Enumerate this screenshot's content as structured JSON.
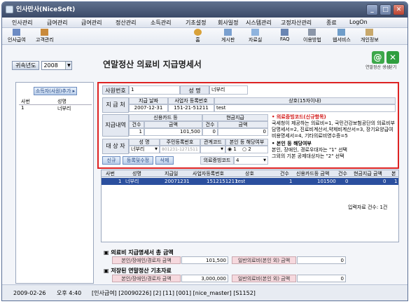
{
  "window": {
    "title": "인사만사(NiceSoft)"
  },
  "menu": [
    "인사관리",
    "급여관리",
    "급여관리",
    "정산관리",
    "소득관리",
    "기초설정",
    "회사일정",
    "시스템관리",
    "고정자산관리",
    "종료",
    "LogOn"
  ],
  "toolbar": {
    "left": [
      "인사급여",
      "고객관리"
    ],
    "right": [
      "홈",
      "게시판",
      "자료실",
      "FAQ",
      "이용방법",
      "웹서비스",
      "개인정보"
    ]
  },
  "page": {
    "title": "연말정산 의료비 지급명세서",
    "year_label": "귀속년도",
    "year_value": "2008",
    "btn_annual": "연말정산 생성",
    "btn_close": "닫기"
  },
  "left": {
    "button": "소득자(사원)추가 ▸",
    "headers": [
      "사번",
      "성명"
    ],
    "rows": [
      [
        "1",
        "너부리"
      ]
    ]
  },
  "form": {
    "emp_no_label": "사원번호",
    "emp_no": "1",
    "name_label": "성 명",
    "name": "너부리",
    "payee_label": "지 급 처",
    "pay_date_h": "지급 날짜",
    "bizno_h": "사업자 등록번호",
    "company_h": "상호(15자이내)",
    "pay_date": "2007-12-31",
    "bizno": "151-21-51211",
    "company": "test",
    "detail_label": "지급내역",
    "card_h": "신용카드 등",
    "cash_h": "현금지급",
    "cnt_h": "건수",
    "amt_h": "금액",
    "card_cnt": "1",
    "card_amt": "101,500",
    "cash_cnt": "0",
    "cash_amt": "0",
    "target_label": "대 상 자",
    "tname_h": "성 명",
    "jumin_h": "주민등록번호",
    "rel_h": "관계코드",
    "self_h": "본인 등 해당여부",
    "tname": "너부리",
    "jumin": "801231-1271511",
    "rel": "",
    "self_opt1": "1",
    "self_opt2": "2",
    "btn_new": "신규",
    "btn_save": "등록및수정",
    "btn_del": "삭제",
    "evidence_label": "의료증빙코드",
    "evidence_value": "4"
  },
  "notice": {
    "title1": "• 의료증빙코드(신규항목)",
    "body1": "국세청이 제공하는 의료비=1, 국민건강보험공단의 의료비부담명세서=2, 진료비계산서,약제비계산서=3, 장기요양급여비용명세서=4, 기타의료비영수증=5",
    "title2": "• 본인 등 해당여부",
    "body2a": "본인, 장애인, 경로우대자는 \"1\" 선택",
    "body2b": "그외의 기본 공제대상자는 \"2\" 선택"
  },
  "grid": {
    "headers": [
      "사번",
      "성명",
      "지급일",
      "사업자등록번호",
      "상호",
      "건수",
      "신용카드등 금액",
      "건수",
      "현금지급 금액",
      "본"
    ],
    "row": [
      "1",
      "너부리",
      "20071231",
      "1512151211",
      "test",
      "1",
      "101500",
      "0",
      "0",
      "1"
    ]
  },
  "summary": {
    "title1": "의료비 지급명세서 총 금액",
    "self_label": "본인/장애인/경로자 금액",
    "self_val": "101,500",
    "gen_label": "일반의료비(본인 외) 금액",
    "gen_val": "0",
    "title2": "저장된 연말정산 기초자료",
    "self_val2": "3,000,000",
    "gen_val2": "0",
    "input_count": "입력자료 건수: 1건"
  },
  "status": {
    "date": "2009-02-26",
    "time": "오후 4:40",
    "info": "[인사급여]  [20090226]  [2]  [11]  [001]  [nice_master]  [S1152]"
  }
}
